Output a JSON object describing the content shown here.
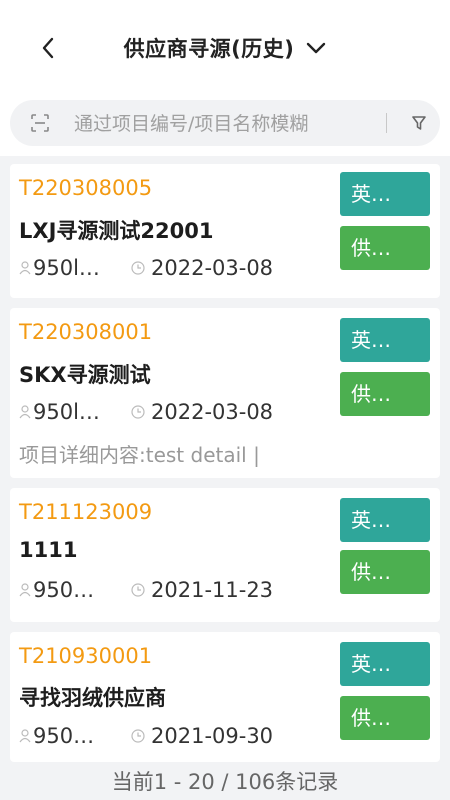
{
  "header": {
    "title": "供应商寻源(历史)"
  },
  "search": {
    "placeholder": "通过项目编号/项目名称模糊"
  },
  "records": [
    {
      "code": "T220308005",
      "name": "LXJ寻源测试22001",
      "buyer": "950l…",
      "date": "2022-03-08",
      "detail": "",
      "tag1": "英…",
      "tag2": "供…"
    },
    {
      "code": "T220308001",
      "name": "SKX寻源测试",
      "buyer": "950l…",
      "date": "2022-03-08",
      "detail": "项目详细内容:test detail |",
      "tag1": "英…",
      "tag2": "供…"
    },
    {
      "code": "T211123009",
      "name": "1111",
      "buyer": "950…",
      "date": "2021-11-23",
      "detail": "",
      "tag1": "英…",
      "tag2": "供…"
    },
    {
      "code": "T210930001",
      "name": "寻找羽绒供应商",
      "buyer": "950…",
      "date": "2021-09-30",
      "detail": "",
      "tag1": "英…",
      "tag2": "供…"
    }
  ],
  "footer": {
    "pagination": "当前1 - 20 / 106条记录"
  },
  "colors": {
    "code": "#f39a12",
    "tag_teal": "#2fa69a",
    "tag_green": "#4caf50"
  }
}
